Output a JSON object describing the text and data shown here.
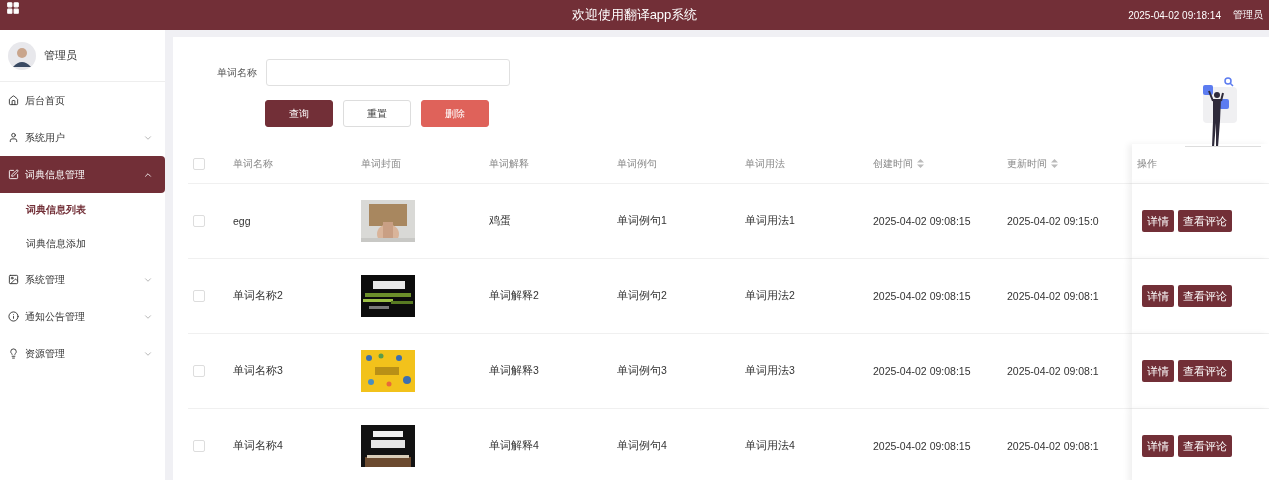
{
  "header": {
    "title": "欢迎使用翻译app系统",
    "datetime": "2025-04-02 09:18:14",
    "user": "管理员"
  },
  "sidebar": {
    "user_name": "管理员",
    "menu": [
      {
        "label": "后台首页",
        "expandable": false,
        "selected": false
      },
      {
        "label": "系统用户",
        "expandable": true,
        "expanded": false,
        "selected": false
      },
      {
        "label": "词典信息管理",
        "expandable": true,
        "expanded": true,
        "selected": true,
        "children": [
          {
            "label": "词典信息列表",
            "selected": true
          },
          {
            "label": "词典信息添加",
            "selected": false
          }
        ]
      },
      {
        "label": "系统管理",
        "expandable": true,
        "expanded": false,
        "selected": false
      },
      {
        "label": "通知公告管理",
        "expandable": true,
        "expanded": false,
        "selected": false
      },
      {
        "label": "资源管理",
        "expandable": true,
        "expanded": false,
        "selected": false
      }
    ]
  },
  "search": {
    "label": "单词名称",
    "buttons": [
      {
        "label": "查询",
        "kind": "primary"
      },
      {
        "label": "重置",
        "kind": "default"
      },
      {
        "label": "删除",
        "kind": "danger"
      }
    ]
  },
  "table": {
    "select_all": false,
    "columns": [
      {
        "label": "单词名称",
        "sortable": false
      },
      {
        "label": "单词封面",
        "sortable": false
      },
      {
        "label": "单词解释",
        "sortable": false
      },
      {
        "label": "单词例句",
        "sortable": false
      },
      {
        "label": "单词用法",
        "sortable": false
      },
      {
        "label": "创建时间",
        "sortable": true
      },
      {
        "label": "更新时间",
        "sortable": true
      },
      {
        "label": "操作",
        "sortable": false
      }
    ],
    "rows": [
      {
        "checked": false,
        "name": "egg",
        "cover": {
          "kind": "picture"
        },
        "explanation": "鸡蛋",
        "example": "单词例句1",
        "usage": "单词用法1",
        "created": "2025-04-02 09:08:15",
        "updated": "2025-04-02 09:15:0",
        "actions": [
          "详情",
          "查看评论"
        ]
      },
      {
        "checked": false,
        "name": "单词名称2",
        "cover": {
          "kind": "picture"
        },
        "explanation": "单词解释2",
        "example": "单词例句2",
        "usage": "单词用法2",
        "created": "2025-04-02 09:08:15",
        "updated": "2025-04-02 09:08:1",
        "actions": [
          "详情",
          "查看评论"
        ]
      },
      {
        "checked": false,
        "name": "单词名称3",
        "cover": {
          "kind": "picture"
        },
        "explanation": "单词解释3",
        "example": "单词例句3",
        "usage": "单词用法3",
        "created": "2025-04-02 09:08:15",
        "updated": "2025-04-02 09:08:1",
        "actions": [
          "详情",
          "查看评论"
        ]
      },
      {
        "checked": false,
        "name": "单词名称4",
        "cover": {
          "kind": "picture"
        },
        "explanation": "单词解释4",
        "example": "单词例句4",
        "usage": "单词用法4",
        "created": "2025-04-02 09:08:15",
        "updated": "2025-04-02 09:08:1",
        "actions": [
          "详情",
          "查看评论"
        ]
      }
    ]
  }
}
